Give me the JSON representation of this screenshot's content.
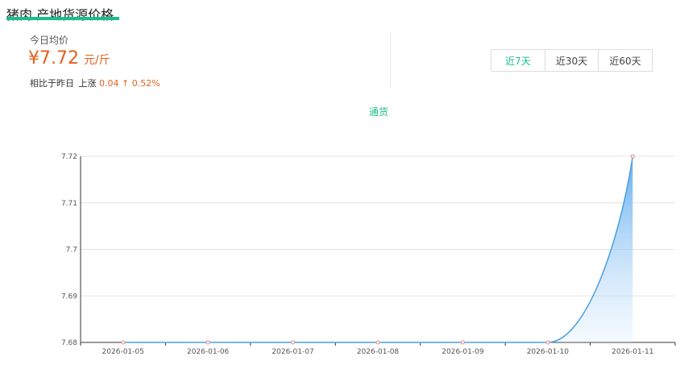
{
  "header": {
    "title": "猪肉 产地货源价格"
  },
  "summary": {
    "label": "今日均价",
    "price": "¥7.72",
    "unit": "元/斤",
    "compare_label": "相比于昨日",
    "trend": "上涨",
    "delta": "0.04",
    "arrow": "↑",
    "percent": "0.52%"
  },
  "tabs": [
    {
      "label": "近7天",
      "active": true
    },
    {
      "label": "近30天",
      "active": false
    },
    {
      "label": "近60天",
      "active": false
    }
  ],
  "colors": {
    "accent": "#19be8c",
    "price": "#e2611d",
    "line": "#4a9fe0"
  },
  "chart_data": {
    "type": "area",
    "x": [
      "2026-01-05",
      "2026-01-06",
      "2026-01-07",
      "2026-01-08",
      "2026-01-09",
      "2026-01-10",
      "2026-01-11"
    ],
    "series": [
      {
        "name": "通货",
        "values": [
          7.68,
          7.68,
          7.68,
          7.68,
          7.68,
          7.68,
          7.72
        ]
      }
    ],
    "yticks": [
      "7.72",
      "7.71",
      "7.7",
      "7.69",
      "7.68"
    ],
    "ylim": [
      7.68,
      7.72
    ],
    "grid": true,
    "legend": "top-center"
  }
}
